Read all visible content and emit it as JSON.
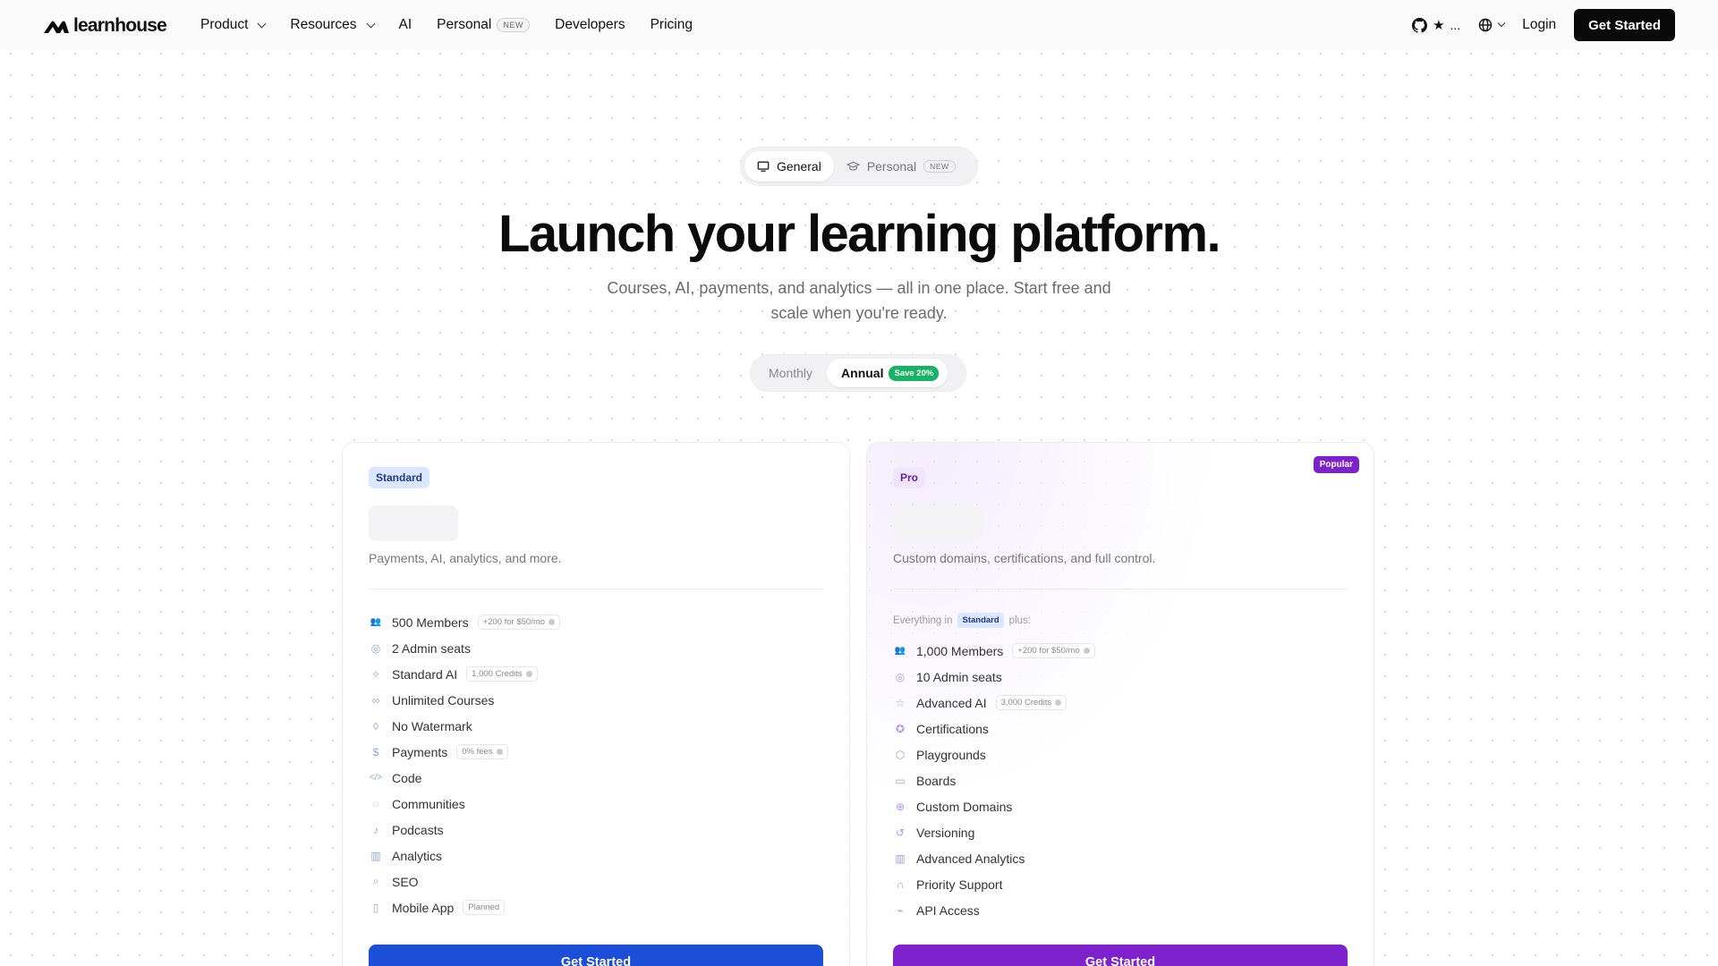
{
  "brand": {
    "name": "learnhouse"
  },
  "nav": {
    "links": [
      {
        "label": "Product"
      },
      {
        "label": "Resources"
      },
      {
        "label": "AI"
      },
      {
        "label": "Personal",
        "badge": "NEW"
      },
      {
        "label": "Developers"
      },
      {
        "label": "Pricing"
      }
    ],
    "github_stars": "...",
    "login": "Login",
    "cta": "Get Started"
  },
  "segment": {
    "general": "General",
    "personal": "Personal",
    "personal_badge": "NEW"
  },
  "hero": {
    "title": "Launch your learning platform.",
    "subtitle": "Courses, AI, payments, and analytics — all in one place. Start free and scale when you're ready."
  },
  "billing": {
    "monthly": "Monthly",
    "annual": "Annual",
    "save": "Save 20%",
    "selected": "annual"
  },
  "plans": {
    "standard": {
      "tag": "Standard",
      "description": "Payments, AI, analytics, and more.",
      "cta": "Get Started",
      "accent": "#1d4ed8",
      "features": [
        {
          "icon": "users-icon",
          "label": "500 Members",
          "badge": "+200 for $50/mo"
        },
        {
          "icon": "admin-icon",
          "label": "2 Admin seats"
        },
        {
          "icon": "sparkle-icon",
          "label": "Standard AI",
          "badge": "1,000 Credits"
        },
        {
          "icon": "infinity-icon",
          "label": "Unlimited Courses"
        },
        {
          "icon": "drop-icon",
          "label": "No Watermark"
        },
        {
          "icon": "dollar-icon",
          "label": "Payments",
          "badge": "0% fees"
        },
        {
          "icon": "code-icon",
          "label": "Code"
        },
        {
          "icon": "chat-icon",
          "label": "Communities"
        },
        {
          "icon": "mic-icon",
          "label": "Podcasts"
        },
        {
          "icon": "chart-icon",
          "label": "Analytics"
        },
        {
          "icon": "search-icon",
          "label": "SEO"
        },
        {
          "icon": "phone-icon",
          "label": "Mobile App",
          "badge": "Planned"
        }
      ]
    },
    "pro": {
      "tag": "Pro",
      "popular": "Popular",
      "description": "Custom domains, certifications, and full control.",
      "everything_prefix": "Everything in",
      "everything_tag": "Standard",
      "everything_suffix": "plus:",
      "cta": "Get Started",
      "accent": "#7e22ce",
      "features": [
        {
          "icon": "users-icon",
          "label": "1,000 Members",
          "badge": "+200 for $50/mo"
        },
        {
          "icon": "admin-icon",
          "label": "10 Admin seats"
        },
        {
          "icon": "star-icon",
          "label": "Advanced AI",
          "badge": "3,000 Credits"
        },
        {
          "icon": "award-icon",
          "label": "Certifications"
        },
        {
          "icon": "box-icon",
          "label": "Playgrounds"
        },
        {
          "icon": "board-icon",
          "label": "Boards"
        },
        {
          "icon": "globe-icon",
          "label": "Custom Domains"
        },
        {
          "icon": "history-icon",
          "label": "Versioning"
        },
        {
          "icon": "chart-icon",
          "label": "Advanced Analytics"
        },
        {
          "icon": "headset-icon",
          "label": "Priority Support"
        },
        {
          "icon": "plug-icon",
          "label": "API Access"
        }
      ]
    }
  }
}
